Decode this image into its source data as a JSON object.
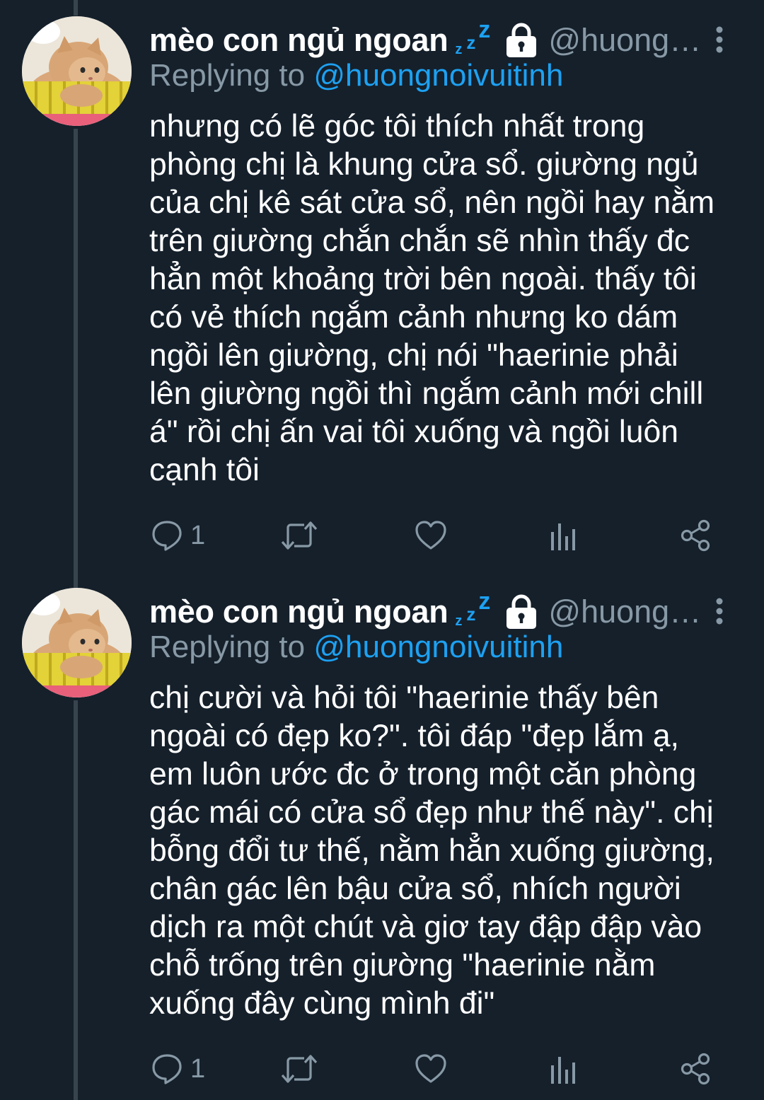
{
  "colors": {
    "background": "#15202b",
    "primary_text": "#ffffff",
    "secondary_text": "#8899a6",
    "accent": "#1da1f2",
    "thread_line": "#38444d"
  },
  "tweets": [
    {
      "display_name": "mèo con ngủ ngoan",
      "zzz": [
        "z",
        "z",
        "z"
      ],
      "handle": "@huongn...",
      "replying_label": "Replying to",
      "replying_to": "@huongnoivuitinh",
      "text": "nhưng có lẽ góc tôi thích nhất trong\nphòng chị là khung cửa sổ. giường ngủ\ncủa chị kê sát cửa sổ, nên ngồi hay nằm\ntrên giường chắn chắn sẽ nhìn thấy đc\nhẳn một khoảng trời bên ngoài. thấy tôi\ncó vẻ thích ngắm cảnh nhưng ko dám\nngồi lên giường, chị nói \"haerinie phải\nlên giường ngồi thì ngắm cảnh mới chill\ná\" rồi chị ấn vai tôi xuống và ngồi luôn\ncạnh tôi",
      "reply_count": "1",
      "icons": [
        "reply-icon",
        "retweet-icon",
        "like-icon",
        "analytics-icon",
        "share-icon",
        "lock-icon",
        "more-icon"
      ]
    },
    {
      "display_name": "mèo con ngủ ngoan",
      "zzz": [
        "z",
        "z",
        "z"
      ],
      "handle": "@huongn...",
      "replying_label": "Replying to",
      "replying_to": "@huongnoivuitinh",
      "text": "chị cười và hỏi tôi \"haerinie thấy bên\nngoài có đẹp ko?\". tôi đáp \"đẹp lắm ạ,\nem luôn ước đc ở trong một căn phòng\ngác mái có cửa sổ đẹp như thế này\". chị\nbỗng đổi tư thế, nằm hẳn xuống giường,\nchân gác lên bậu cửa sổ, nhích người\ndịch ra một chút và giơ tay đập đập vào\nchỗ trống trên giường \"haerinie nằm\nxuống đây cùng mình đi\"",
      "reply_count": "1",
      "icons": [
        "reply-icon",
        "retweet-icon",
        "like-icon",
        "analytics-icon",
        "share-icon",
        "lock-icon",
        "more-icon"
      ]
    }
  ]
}
